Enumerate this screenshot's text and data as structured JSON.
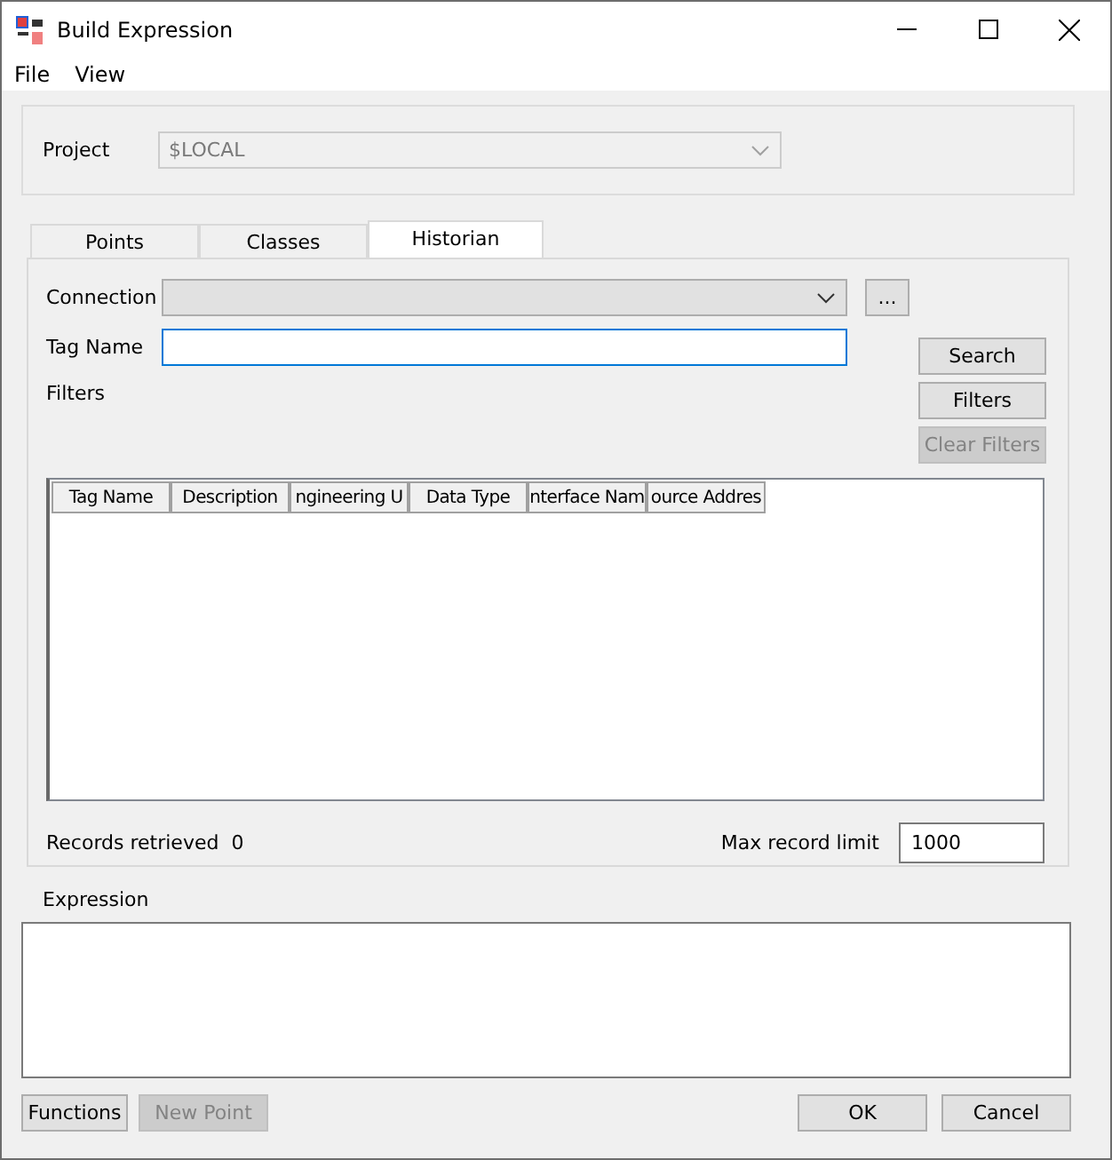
{
  "window": {
    "title": "Build Expression"
  },
  "menu": [
    {
      "label": "File"
    },
    {
      "label": "View"
    }
  ],
  "project": {
    "label": "Project",
    "value": "$LOCAL",
    "disabled": true
  },
  "tabs": [
    {
      "label": "Points",
      "selected": false
    },
    {
      "label": "Classes",
      "selected": false
    },
    {
      "label": "Historian",
      "selected": true
    }
  ],
  "connection": {
    "label": "Connection",
    "browse_button": "..."
  },
  "tag_name": {
    "label": "Tag Name"
  },
  "filters_label": "Filters",
  "side_buttons": [
    {
      "label": "Search",
      "disabled": false
    },
    {
      "label": "Filters",
      "disabled": false
    },
    {
      "label": "Clear Filters",
      "disabled": true
    }
  ],
  "table": {
    "columns": [
      "Tag Name",
      "Description",
      "ngineering U",
      "Data Type",
      "nterface Nam",
      "ource Addres"
    ]
  },
  "records": {
    "label": "Records retrieved",
    "value": "0"
  },
  "max_record": {
    "label": "Max record limit",
    "value": "1000"
  },
  "expression": {
    "label": "Expression"
  },
  "bottom_left_buttons": [
    {
      "label": "Functions",
      "disabled": false
    },
    {
      "label": "New Point",
      "disabled": true
    }
  ],
  "bottom_right_buttons": [
    {
      "label": "OK",
      "disabled": false
    },
    {
      "label": "Cancel",
      "disabled": false
    }
  ]
}
